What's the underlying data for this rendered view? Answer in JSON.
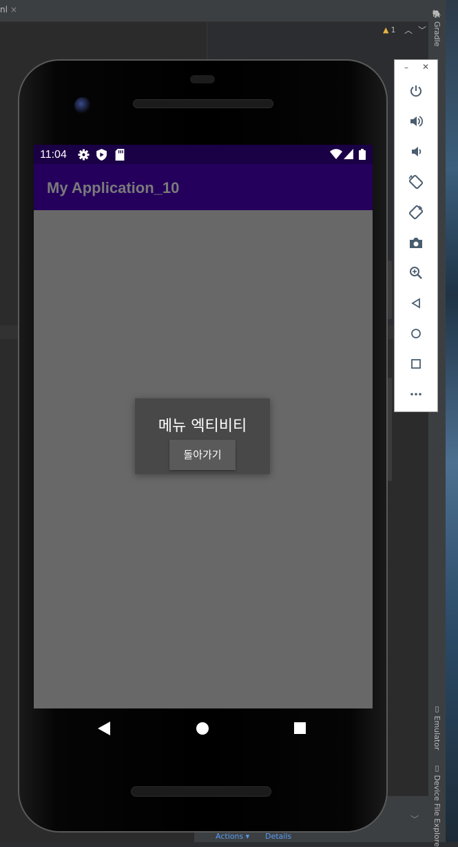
{
  "ide": {
    "tab_label": "nl",
    "warning_count": "1",
    "gradle_label": "Gradle",
    "emulator_label": "Emulator",
    "device_file_explorer_label": "Device File Explore",
    "actions_label": "Actions ▾",
    "details_label": "Details"
  },
  "device": {
    "status_time": "11:04",
    "app_title": "My Application_10",
    "dialog_title": "메뉴 엑티비티",
    "dialog_button": "돌아가기"
  },
  "emulator_toolbar": {
    "buttons": [
      "power-icon",
      "volume-up-icon",
      "volume-down-icon",
      "rotate-left-icon",
      "rotate-right-icon",
      "camera-icon",
      "zoom-icon",
      "back-icon",
      "home-icon",
      "overview-icon",
      "more-icon"
    ]
  },
  "colors": {
    "status_bar": "#1a0045",
    "app_bar": "#24005c",
    "screen_bg": "#686868",
    "dialog_bg": "#484848",
    "ide_bg": "#2b2d30"
  }
}
